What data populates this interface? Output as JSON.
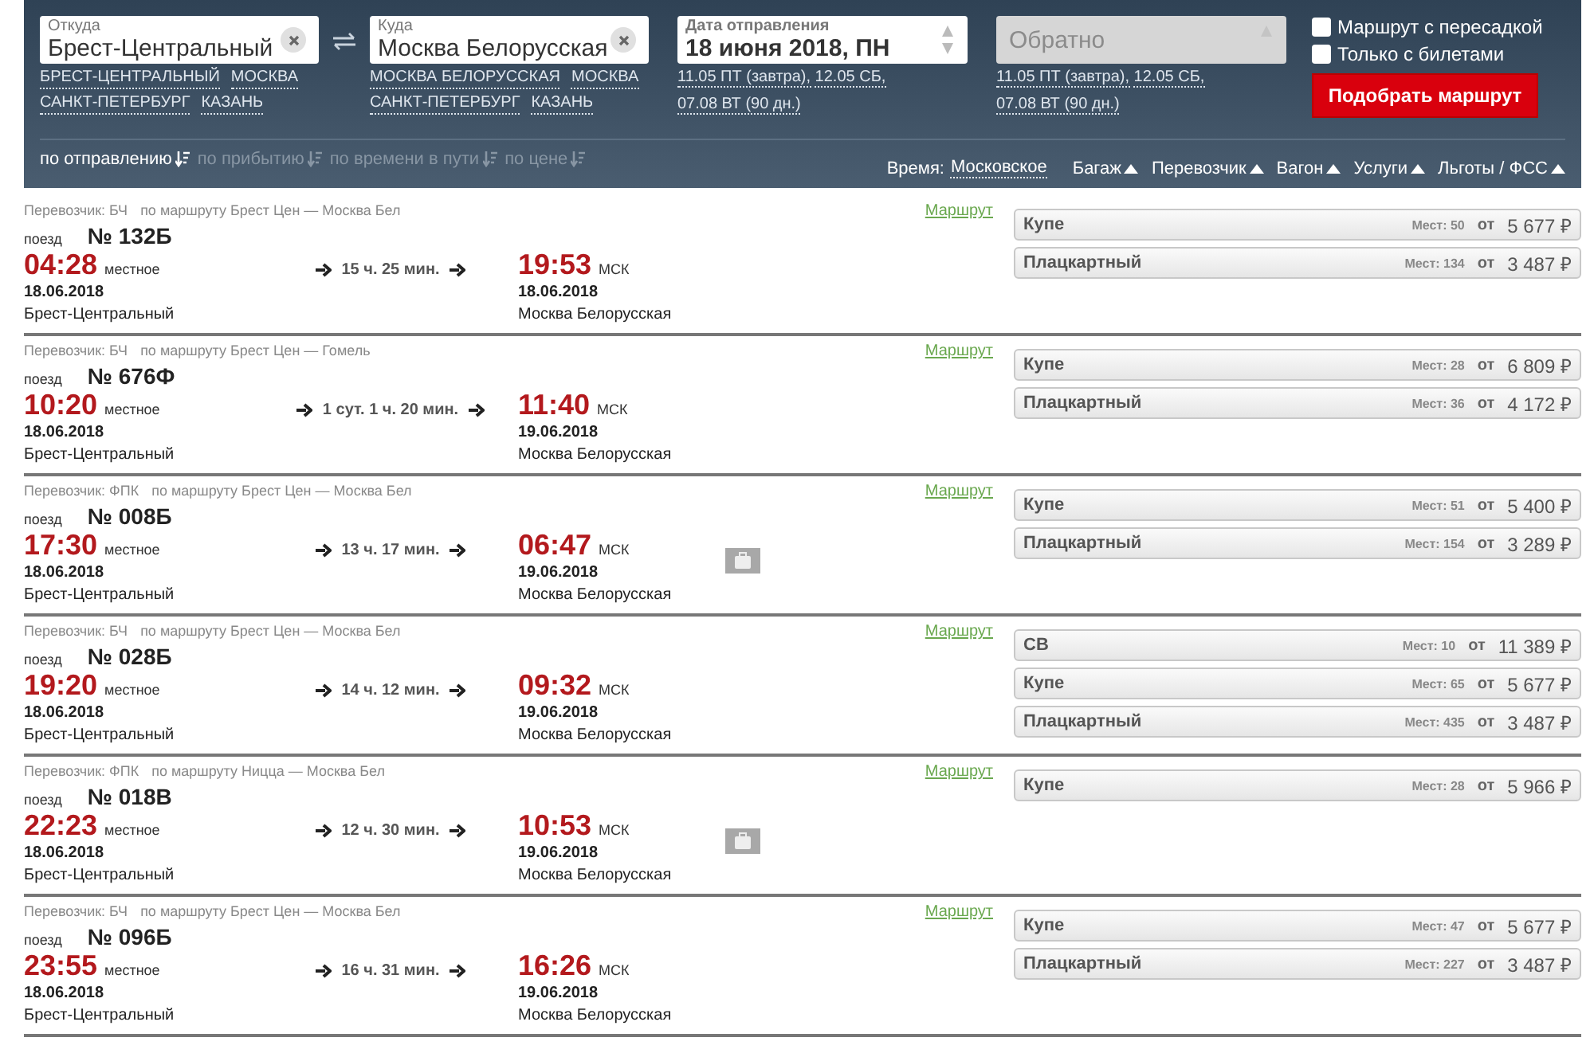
{
  "search": {
    "from": {
      "label": "Откуда",
      "value": "Брест-Центральный",
      "suggestions": [
        "БРЕСТ-ЦЕНТРАЛЬНЫЙ",
        "МОСКВА",
        "САНКТ-ПЕТЕРБУРГ",
        "КАЗАНЬ"
      ]
    },
    "to": {
      "label": "Куда",
      "value": "Москва Белорусская",
      "suggestions": [
        "МОСКВА БЕЛОРУССКАЯ",
        "МОСКВА",
        "САНКТ-ПЕТЕРБУРГ",
        "КАЗАНЬ"
      ]
    },
    "date": {
      "label": "Дата отправления",
      "value": "18 июня 2018, ПН",
      "quick_dates": [
        "11.05 ПТ (завтра),",
        "12.05 СБ,",
        "07.08 ВТ (90 дн.)"
      ]
    },
    "return": {
      "placeholder": "Обратно",
      "quick_dates": [
        "11.05 ПТ (завтра),",
        "12.05 СБ,",
        "07.08 ВТ (90 дн.)"
      ]
    },
    "options": [
      {
        "label": "Маршрут с пересадкой",
        "checked": false
      },
      {
        "label": "Только с билетами",
        "checked": false
      }
    ],
    "submit": "Подобрать маршрут"
  },
  "sort": [
    {
      "label": "по отправлению",
      "selected": true
    },
    {
      "label": "по прибытию",
      "selected": false
    },
    {
      "label": "по времени в пути",
      "selected": false
    },
    {
      "label": "по цене",
      "selected": false
    }
  ],
  "time_zone": {
    "label": "Время:",
    "value": "Московское"
  },
  "filters": [
    "Багаж",
    "Перевозчик",
    "Вагон",
    "Услуги",
    "Льготы / ФСС"
  ],
  "trains": [
    {
      "carrier": "Перевозчик: БЧ",
      "route": "по маршруту Брест Цен — Москва Бел",
      "route_link": "Маршрут",
      "train_label": "поезд",
      "number": "№ 132Б",
      "dep_time": "04:28",
      "dep_zone": "местное",
      "dep_date": "18.06.2018",
      "dep_station": "Брест-Центральный",
      "duration": "15 ч. 25 мин.",
      "arr_time": "19:53",
      "arr_zone": "МСК",
      "arr_date": "18.06.2018",
      "arr_station": "Москва Белорусская",
      "baggage": false,
      "cars": [
        {
          "type": "Купе",
          "seats": "Мест: 50",
          "from": "от",
          "price": "5 677 ₽"
        },
        {
          "type": "Плацкартный",
          "seats": "Мест: 134",
          "from": "от",
          "price": "3 487 ₽"
        }
      ]
    },
    {
      "carrier": "Перевозчик: БЧ",
      "route": "по маршруту Брест Цен — Гомель",
      "route_link": "Маршрут",
      "train_label": "поезд",
      "number": "№ 676Ф",
      "dep_time": "10:20",
      "dep_zone": "местное",
      "dep_date": "18.06.2018",
      "dep_station": "Брест-Центральный",
      "duration": "1 сут. 1 ч. 20 мин.",
      "arr_time": "11:40",
      "arr_zone": "МСК",
      "arr_date": "19.06.2018",
      "arr_station": "Москва Белорусская",
      "baggage": false,
      "cars": [
        {
          "type": "Купе",
          "seats": "Мест: 28",
          "from": "от",
          "price": "6 809 ₽"
        },
        {
          "type": "Плацкартный",
          "seats": "Мест: 36",
          "from": "от",
          "price": "4 172 ₽"
        }
      ]
    },
    {
      "carrier": "Перевозчик: ФПК",
      "route": "по маршруту Брест Цен — Москва Бел",
      "route_link": "Маршрут",
      "train_label": "поезд",
      "number": "№ 008Б",
      "dep_time": "17:30",
      "dep_zone": "местное",
      "dep_date": "18.06.2018",
      "dep_station": "Брест-Центральный",
      "duration": "13 ч. 17 мин.",
      "arr_time": "06:47",
      "arr_zone": "МСК",
      "arr_date": "19.06.2018",
      "arr_station": "Москва Белорусская",
      "baggage": true,
      "cars": [
        {
          "type": "Купе",
          "seats": "Мест: 51",
          "from": "от",
          "price": "5 400 ₽"
        },
        {
          "type": "Плацкартный",
          "seats": "Мест: 154",
          "from": "от",
          "price": "3 289 ₽"
        }
      ]
    },
    {
      "carrier": "Перевозчик: БЧ",
      "route": "по маршруту Брест Цен — Москва Бел",
      "route_link": "Маршрут",
      "train_label": "поезд",
      "number": "№ 028Б",
      "dep_time": "19:20",
      "dep_zone": "местное",
      "dep_date": "18.06.2018",
      "dep_station": "Брест-Центральный",
      "duration": "14 ч. 12 мин.",
      "arr_time": "09:32",
      "arr_zone": "МСК",
      "arr_date": "19.06.2018",
      "arr_station": "Москва Белорусская",
      "baggage": false,
      "cars": [
        {
          "type": "СВ",
          "seats": "Мест: 10",
          "from": "от",
          "price": "11 389 ₽"
        },
        {
          "type": "Купе",
          "seats": "Мест: 65",
          "from": "от",
          "price": "5 677 ₽"
        },
        {
          "type": "Плацкартный",
          "seats": "Мест: 435",
          "from": "от",
          "price": "3 487 ₽"
        }
      ]
    },
    {
      "carrier": "Перевозчик: ФПК",
      "route": "по маршруту Ницца — Москва Бел",
      "route_link": "Маршрут",
      "train_label": "поезд",
      "number": "№ 018В",
      "dep_time": "22:23",
      "dep_zone": "местное",
      "dep_date": "18.06.2018",
      "dep_station": "Брест-Центральный",
      "duration": "12 ч. 30 мин.",
      "arr_time": "10:53",
      "arr_zone": "МСК",
      "arr_date": "19.06.2018",
      "arr_station": "Москва Белорусская",
      "baggage": true,
      "cars": [
        {
          "type": "Купе",
          "seats": "Мест: 28",
          "from": "от",
          "price": "5 966 ₽"
        }
      ]
    },
    {
      "carrier": "Перевозчик: БЧ",
      "route": "по маршруту Брест Цен — Москва Бел",
      "route_link": "Маршрут",
      "train_label": "поезд",
      "number": "№ 096Б",
      "dep_time": "23:55",
      "dep_zone": "местное",
      "dep_date": "18.06.2018",
      "dep_station": "Брест-Центральный",
      "duration": "16 ч. 31 мин.",
      "arr_time": "16:26",
      "arr_zone": "МСК",
      "arr_date": "19.06.2018",
      "arr_station": "Москва Белорусская",
      "baggage": false,
      "cars": [
        {
          "type": "Купе",
          "seats": "Мест: 47",
          "from": "от",
          "price": "5 677 ₽"
        },
        {
          "type": "Плацкартный",
          "seats": "Мест: 227",
          "from": "от",
          "price": "3 487 ₽"
        }
      ]
    }
  ]
}
